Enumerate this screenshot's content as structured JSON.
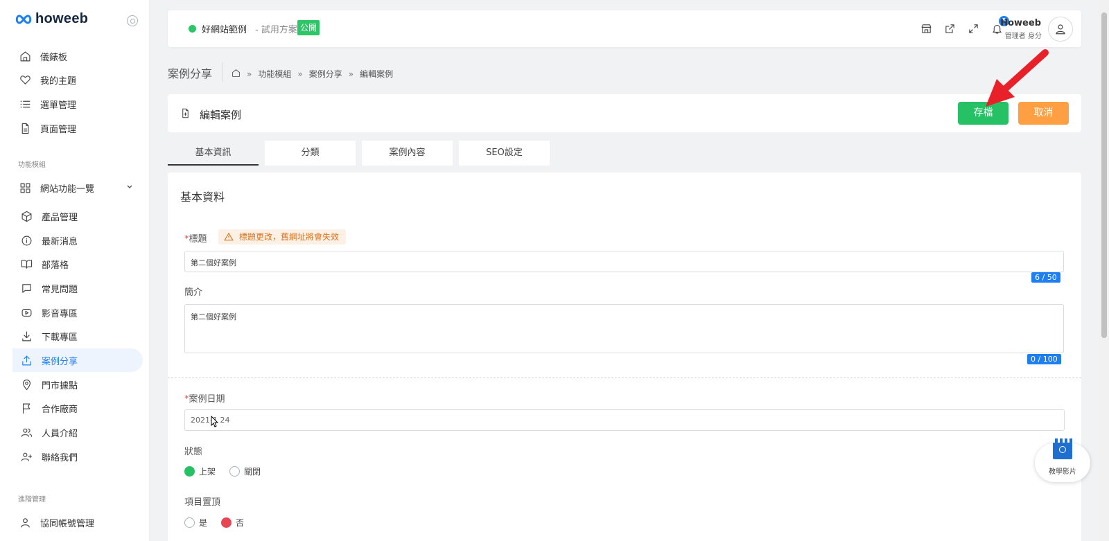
{
  "brand": {
    "name": "howeeb"
  },
  "sidebar": {
    "top_items": [
      {
        "label": "儀錶板",
        "icon": "home-icon"
      },
      {
        "label": "我的主題",
        "icon": "heart-icon"
      },
      {
        "label": "選單管理",
        "icon": "list-icon"
      },
      {
        "label": "頁面管理",
        "icon": "file-icon"
      }
    ],
    "module_section": "功能模組",
    "site_features": "網站功能一覽",
    "sub_items": [
      {
        "label": "產品管理",
        "icon": "box-icon"
      },
      {
        "label": "最新消息",
        "icon": "info-icon"
      },
      {
        "label": "部落格",
        "icon": "book-icon"
      },
      {
        "label": "常見問題",
        "icon": "message-icon"
      },
      {
        "label": "影音專區",
        "icon": "video-icon"
      },
      {
        "label": "下載專區",
        "icon": "download-icon"
      },
      {
        "label": "案例分享",
        "icon": "share-icon",
        "active": true
      },
      {
        "label": "門市據點",
        "icon": "map-pin-icon"
      },
      {
        "label": "合作廠商",
        "icon": "flag-icon"
      },
      {
        "label": "人員介紹",
        "icon": "users-icon"
      },
      {
        "label": "聯絡我們",
        "icon": "user-plus-icon"
      }
    ],
    "advanced_section": "進階管理",
    "advanced_items": [
      {
        "label": "協同帳號管理",
        "icon": "user-icon"
      }
    ]
  },
  "header": {
    "site_name": "好網站範例",
    "plan": "- 試用方案",
    "public_badge": "公開",
    "notification_count": "5",
    "user_name": "Howeeb",
    "user_role": "管理者 身分"
  },
  "page": {
    "title": "案例分享",
    "breadcrumb": [
      "功能模組",
      "案例分享",
      "編輯案例"
    ]
  },
  "edit": {
    "title": "編輯案例",
    "save_label": "存檔",
    "cancel_label": "取消"
  },
  "tabs": [
    "基本資訊",
    "分類",
    "案例內容",
    "SEO設定"
  ],
  "form": {
    "section_title": "基本資料",
    "title_label": "標題",
    "title_warning": "標題更改，舊網址將會失效",
    "title_value": "第二個好案例",
    "title_counter": "6 / 50",
    "intro_label": "簡介",
    "intro_value": "第二個好案例",
    "intro_counter": "0 / 100",
    "date_label": "案例日期",
    "date_value": "2021-1 24",
    "status_label": "狀態",
    "status_on": "上架",
    "status_off": "關閉",
    "pin_label": "項目置頂",
    "pin_yes": "是",
    "pin_no": "否"
  },
  "tutorial": {
    "label": "教學影片"
  },
  "colors": {
    "accent": "#1d7ff2",
    "save": "#27c165",
    "cancel": "#ff9f43",
    "arrow": "#e8202a"
  }
}
